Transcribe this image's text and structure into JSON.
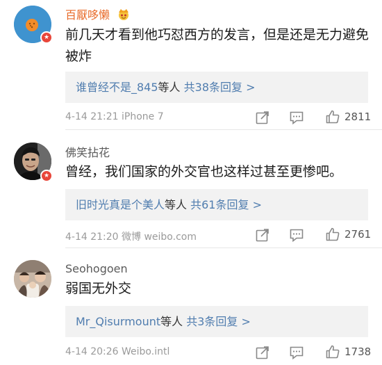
{
  "comments": [
    {
      "username": "百厭哆懒",
      "text": "前几天才看到他巧怼西方的发言，但是还是无力避免被炸",
      "reply_users": "谁曾经不是_845",
      "reply_suffix": "等人",
      "reply_count": "共38条回复 >",
      "meta": "4-14 21:21 iPhone 7",
      "likes": "2811"
    },
    {
      "username": "佛笑拈花",
      "text": "曾经，我们国家的外交官也这样过甚至更惨吧。",
      "reply_users": "旧时光真是个美人",
      "reply_suffix": "等人",
      "reply_count": "共61条回复 >",
      "meta": "4-14 21:20 微博 weibo.com",
      "likes": "2761"
    },
    {
      "username": "Seohogoen",
      "text": "弱国无外交",
      "reply_users": "Mr_Qisurmount",
      "reply_suffix": "等人",
      "reply_count": "共3条回复 >",
      "meta": "4-14 20:26 Weibo.intl",
      "likes": "1738"
    }
  ],
  "icons": {
    "repost": "share-icon",
    "comment": "comment-icon",
    "like": "thumbs-up-icon",
    "verified": "verified-badge-icon",
    "crown": "crown-emoji-icon"
  },
  "colors": {
    "link_blue": "#507daf",
    "username_orange": "#e86b2a",
    "badge_red": "#e8463a",
    "reply_bg": "#f2f2f2"
  }
}
